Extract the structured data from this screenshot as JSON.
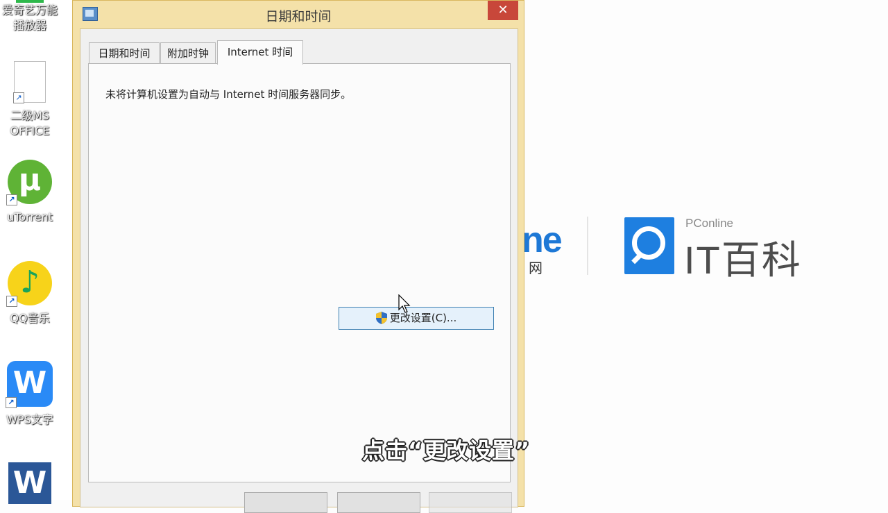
{
  "desktop": {
    "icons": [
      {
        "name": "iqiyi",
        "label_line1": "爱奇艺万能",
        "label_line2": "播放器"
      },
      {
        "name": "ms-office-doc",
        "label_line1": "二级MS",
        "label_line2": "OFFICE"
      },
      {
        "name": "utorrent",
        "label_line1": "uTorrent",
        "label_line2": ""
      },
      {
        "name": "qq-music",
        "label_line1": "QQ音乐",
        "label_line2": ""
      },
      {
        "name": "wps-writer",
        "label_line1": "WPS文字",
        "label_line2": ""
      },
      {
        "name": "word",
        "label_line1": "",
        "label_line2": ""
      }
    ]
  },
  "brand": {
    "fragment": "ne",
    "fragment2": "网",
    "small": "PConline",
    "big": "IT百科",
    "color": "#1e7fe0"
  },
  "dialog": {
    "title": "日期和时间",
    "close_label": "✕",
    "tabs": [
      {
        "label": "日期和时间",
        "active": false
      },
      {
        "label": "附加时钟",
        "active": false
      },
      {
        "label": "Internet 时间",
        "active": true
      }
    ],
    "message": "未将计算机设置为自动与 Internet 时间服务器同步。",
    "change_button": "更改设置(C)..."
  },
  "subtitle": "点击“更改设置”",
  "colors": {
    "title_bar": "#f4e1a9",
    "close": "#c8473a",
    "button_hover": "#e5f1fb"
  }
}
